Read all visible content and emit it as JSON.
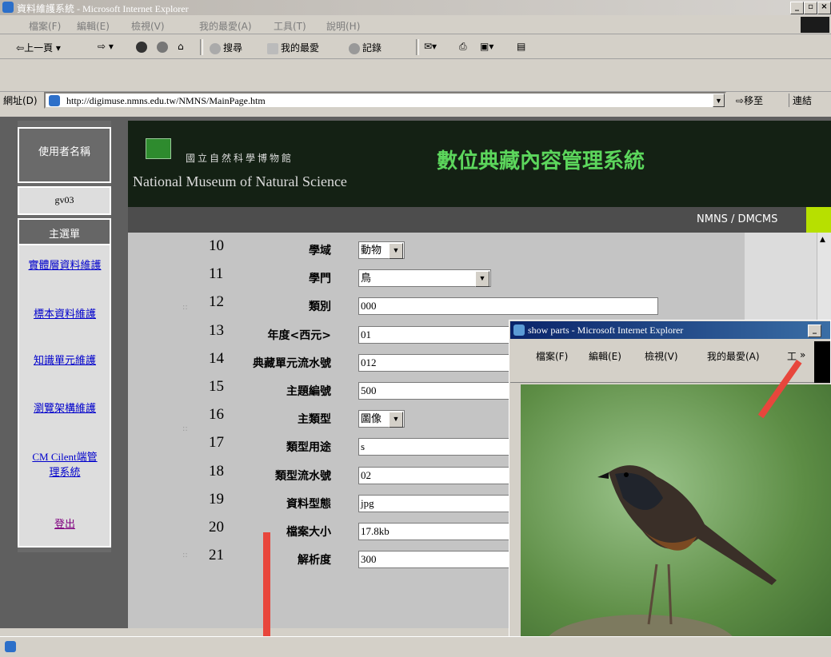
{
  "window": {
    "title": "資料維護系統 - Microsoft Internet Explorer",
    "controls": [
      "_",
      "▫",
      "×"
    ]
  },
  "menu": [
    "檔案(F)",
    "編輯(E)",
    "檢視(V)",
    "我的最愛(A)",
    "工具(T)",
    "說明(H)"
  ],
  "toolbar": {
    "back": "上一頁",
    "search": "搜尋",
    "favorites": "我的最愛",
    "history": "記錄"
  },
  "address": {
    "label": "網址(D)",
    "url": "http://digimuse.nmns.edu.tw/NMNS/MainPage.htm",
    "go": "移至",
    "links": "連結"
  },
  "sidebar": {
    "user_label": "使用者名稱",
    "user_value": "gv03",
    "main_menu": "主選單",
    "items": [
      "實體層資料維護",
      "標本資料維護",
      "知識單元維護",
      "瀏覽架構維護",
      "CM Cilent端管理系統",
      "登出"
    ]
  },
  "header": {
    "museum_cn": "國立自然科學博物館",
    "museum_en": "National Museum of Natural Science",
    "system_title": "數位典藏內容管理系統",
    "breadcrumb": "NMNS / DMCMS",
    "accent_color": "#b7e000"
  },
  "rows": [
    {
      "num": "10",
      "label": "學域",
      "value": "動物",
      "type": "select"
    },
    {
      "num": "11",
      "label": "學門",
      "value": "鳥",
      "type": "select"
    },
    {
      "num": "12",
      "label": "類別",
      "value": "000",
      "type": "text"
    },
    {
      "num": "13",
      "label": "年度<西元>",
      "value": "01",
      "type": "text"
    },
    {
      "num": "14",
      "label": "典藏單元流水號",
      "value": "012",
      "type": "text"
    },
    {
      "num": "15",
      "label": "主題編號",
      "value": "500",
      "type": "text"
    },
    {
      "num": "16",
      "label": "主類型",
      "value": "圖像",
      "type": "select"
    },
    {
      "num": "17",
      "label": "類型用途",
      "value": "s",
      "type": "text"
    },
    {
      "num": "18",
      "label": "類型流水號",
      "value": "02",
      "type": "text"
    },
    {
      "num": "19",
      "label": "資料型態",
      "value": "jpg",
      "type": "text"
    },
    {
      "num": "20",
      "label": "檔案大小",
      "value": "17.8kb",
      "type": "text"
    },
    {
      "num": "21",
      "label": "解析度",
      "value": "300",
      "type": "text"
    }
  ],
  "popup": {
    "title": "show parts - Microsoft Internet Explorer",
    "menu": [
      "檔案(F)",
      "編輯(E)",
      "檢視(V)",
      "我的最愛(A)",
      "工"
    ]
  }
}
